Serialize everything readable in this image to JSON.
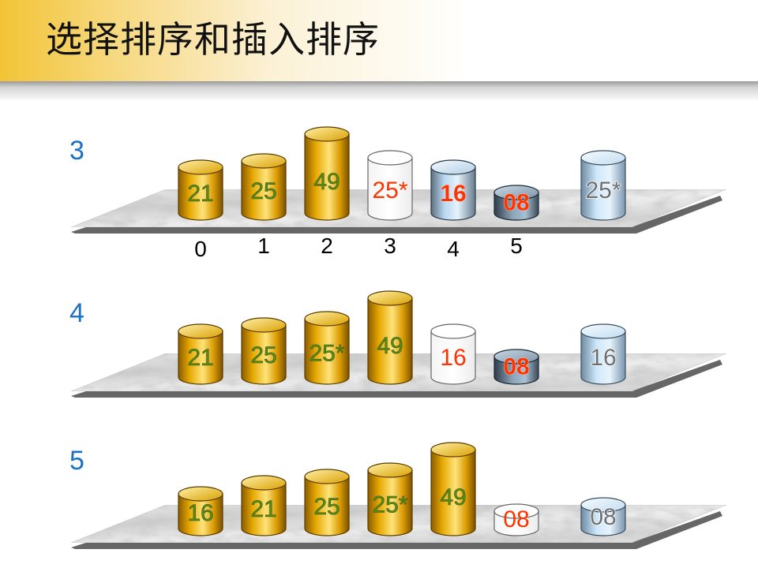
{
  "title": "选择排序和插入排序",
  "colors": {
    "gold": "#e9b000",
    "temp": "#c8e6fb",
    "hollow": "#ffffff",
    "stepLabel": "#1d71c4",
    "labelGreen": "#5a8a1a",
    "labelRed": "#ff3300",
    "labelGrey": "#6e6e6e"
  },
  "rows": [
    {
      "step": "3",
      "indices": [
        "0",
        "1",
        "2",
        "3",
        "4",
        "5"
      ],
      "cells": [
        {
          "value": "21",
          "style": "gold",
          "label": "green"
        },
        {
          "value": "25",
          "style": "gold",
          "label": "green"
        },
        {
          "value": "49",
          "style": "gold",
          "label": "green"
        },
        {
          "value": "25*",
          "style": "hollow",
          "label": "red"
        },
        {
          "value": "16",
          "style": "blue",
          "label": "red-bold"
        },
        {
          "value": "08",
          "style": "dark",
          "label": "red-bold"
        }
      ],
      "temp": {
        "value": "25*",
        "style": "temp",
        "label": "grey"
      }
    },
    {
      "step": "4",
      "cells": [
        {
          "value": "21",
          "style": "gold",
          "label": "green"
        },
        {
          "value": "25",
          "style": "gold",
          "label": "green"
        },
        {
          "value": "25*",
          "style": "gold",
          "label": "green"
        },
        {
          "value": "49",
          "style": "gold",
          "label": "green"
        },
        {
          "value": "16",
          "style": "hollow",
          "label": "red"
        },
        {
          "value": "08",
          "style": "dark",
          "label": "red-bold"
        }
      ],
      "temp": {
        "value": "16",
        "style": "temp",
        "label": "grey"
      }
    },
    {
      "step": "5",
      "cells": [
        {
          "value": "16",
          "style": "gold",
          "label": "green"
        },
        {
          "value": "21",
          "style": "gold",
          "label": "green"
        },
        {
          "value": "25",
          "style": "gold",
          "label": "green"
        },
        {
          "value": "25*",
          "style": "gold",
          "label": "green"
        },
        {
          "value": "49",
          "style": "gold",
          "label": "green"
        },
        {
          "value": "08",
          "style": "hollow",
          "label": "red"
        }
      ],
      "temp": {
        "value": "08",
        "style": "temp",
        "label": "grey"
      }
    }
  ]
}
